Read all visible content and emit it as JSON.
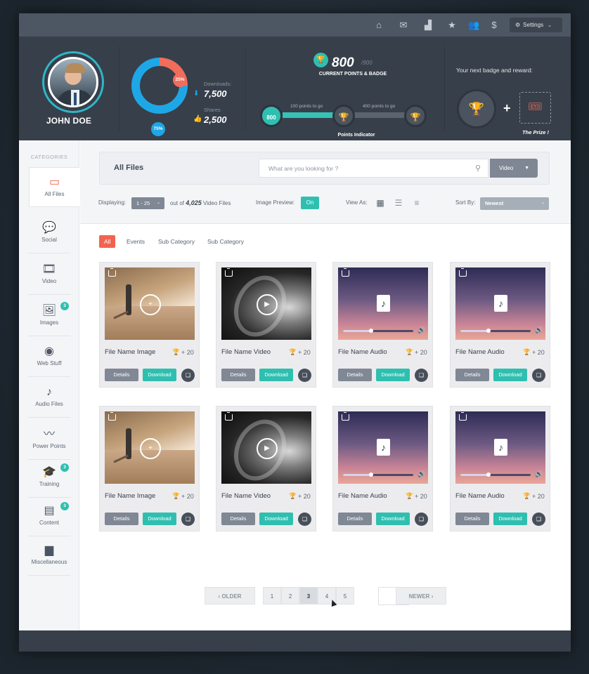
{
  "topnav": {
    "icons": [
      "home-icon",
      "mail-icon",
      "chart-icon",
      "star-icon",
      "users-icon",
      "dollar-icon"
    ],
    "settings_label": "Settings"
  },
  "profile": {
    "name": "JOHN DOE"
  },
  "stats": {
    "downloads_pct": "75%",
    "shares_pct": "25%",
    "downloads_label": "Downloads:",
    "downloads_value": "7,500",
    "shares_label": "Shares",
    "shares_value": "2,500",
    "downloads_fraction": 0.75,
    "shares_fraction": 0.25,
    "colors": {
      "downloads": "#1ea7e6",
      "shares": "#f06d5c"
    }
  },
  "points": {
    "current": "800",
    "max": "/900",
    "label": "CURRENT POINTS & BADGE",
    "start_value": "800",
    "to_go_1": "100 points to go",
    "to_go_2": "400 points to go",
    "indicator_label": "Points Indicator",
    "progress_fraction": 0.4
  },
  "reward": {
    "label": "Your next badge and reward:",
    "prize_label": "The Prize !"
  },
  "sidebar": {
    "categories_label": "CATEGORIES",
    "items": [
      {
        "label": "All Files",
        "icon": "monitor-icon",
        "badge": ""
      },
      {
        "label": "Social",
        "icon": "chat-icon",
        "badge": ""
      },
      {
        "label": "Video",
        "icon": "film-icon",
        "badge": ""
      },
      {
        "label": "Images",
        "icon": "images-icon",
        "badge": "3"
      },
      {
        "label": "Web Stuff",
        "icon": "globe-icon",
        "badge": ""
      },
      {
        "label": "Audio Files",
        "icon": "music-file-icon",
        "badge": ""
      },
      {
        "label": "Power Points",
        "icon": "trend-icon",
        "badge": ""
      },
      {
        "label": "Training",
        "icon": "graduation-cap-icon",
        "badge": "3"
      },
      {
        "label": "Content",
        "icon": "document-icon",
        "badge": "3"
      },
      {
        "label": "Miscellaneous",
        "icon": "archive-icon",
        "badge": ""
      }
    ]
  },
  "filebar": {
    "title": "All Files",
    "search_placeholder": "What are you looking for ?",
    "type_select": "Video"
  },
  "options": {
    "displaying_label": "Displaying:",
    "displaying_value": "1 - 25",
    "out_of_prefix": "out of",
    "out_of_count": "4,025",
    "out_of_suffix": "Video Files",
    "preview_label": "Image Preview:",
    "preview_value": "On",
    "view_label": "View As:",
    "sort_label": "Sort By:",
    "sort_value": "Newest"
  },
  "tabs": [
    "All",
    "Events",
    "Sub Category",
    "Sub Category"
  ],
  "cards": [
    {
      "type": "image",
      "name": "File Name Image",
      "points": "+ 20"
    },
    {
      "type": "video",
      "name": "File Name Video",
      "points": "+ 20"
    },
    {
      "type": "audio",
      "name": "File Name Audio",
      "points": "+ 20"
    },
    {
      "type": "audio",
      "name": "File Name Audio",
      "points": "+ 20"
    },
    {
      "type": "image",
      "name": "File Name Image",
      "points": "+ 20"
    },
    {
      "type": "video",
      "name": "File Name Video",
      "points": "+ 20"
    },
    {
      "type": "audio",
      "name": "File Name Audio",
      "points": "+ 20"
    },
    {
      "type": "audio",
      "name": "File Name Audio",
      "points": "+ 20"
    }
  ],
  "card_buttons": {
    "details": "Details",
    "download": "Download"
  },
  "pagination": {
    "older": "OLDER",
    "newer": "NEWER",
    "pages": [
      "1",
      "2",
      "3",
      "4",
      "5"
    ],
    "current": "3"
  }
}
